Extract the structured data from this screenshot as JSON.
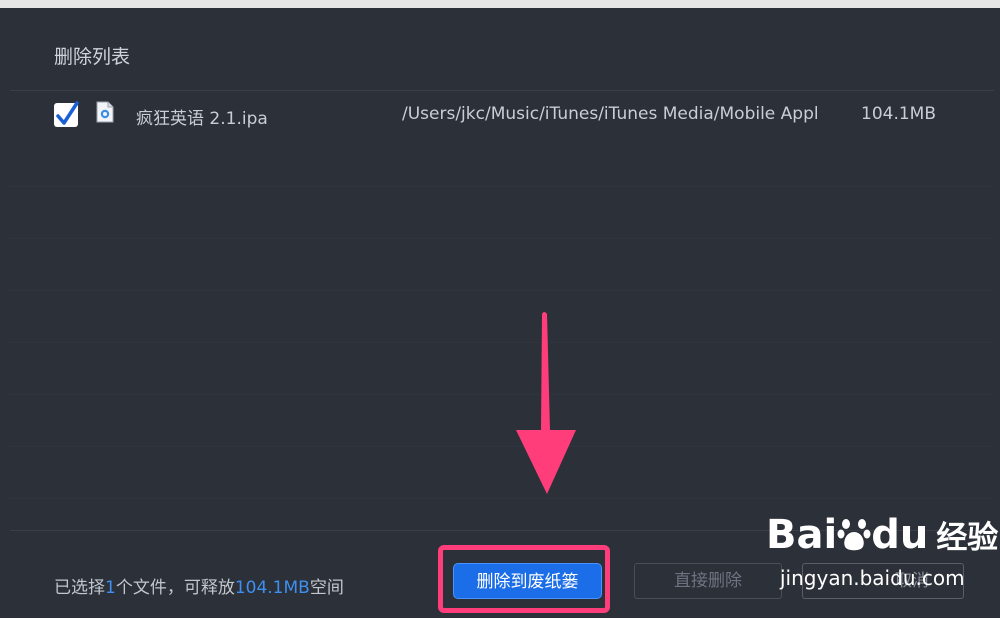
{
  "dialog": {
    "title": "删除列表"
  },
  "files": [
    {
      "checked": true,
      "icon": "ipa-file-icon",
      "name": "疯狂英语 2.1.ipa",
      "path": "/Users/jkc/Music/iTunes/iTunes Media/Mobile Applications/",
      "size": "104.1MB"
    }
  ],
  "footer": {
    "status_prefix": "已选择",
    "status_count": "1",
    "status_mid": "个文件，可释放",
    "status_size": "104.1MB",
    "status_suffix": "空间",
    "trash_button": "删除到废纸篓",
    "delete_button": "直接删除",
    "cancel_button": "取消"
  },
  "watermark": {
    "logo_bai": "Bai",
    "logo_du": "du",
    "logo_jingyan": "经验",
    "url": "jingyan.baidu.com"
  },
  "colors": {
    "accent": "#1c6ee8",
    "highlight": "#3d8ff2",
    "annotation": "#ff3d7a",
    "background": "#2c3038"
  }
}
